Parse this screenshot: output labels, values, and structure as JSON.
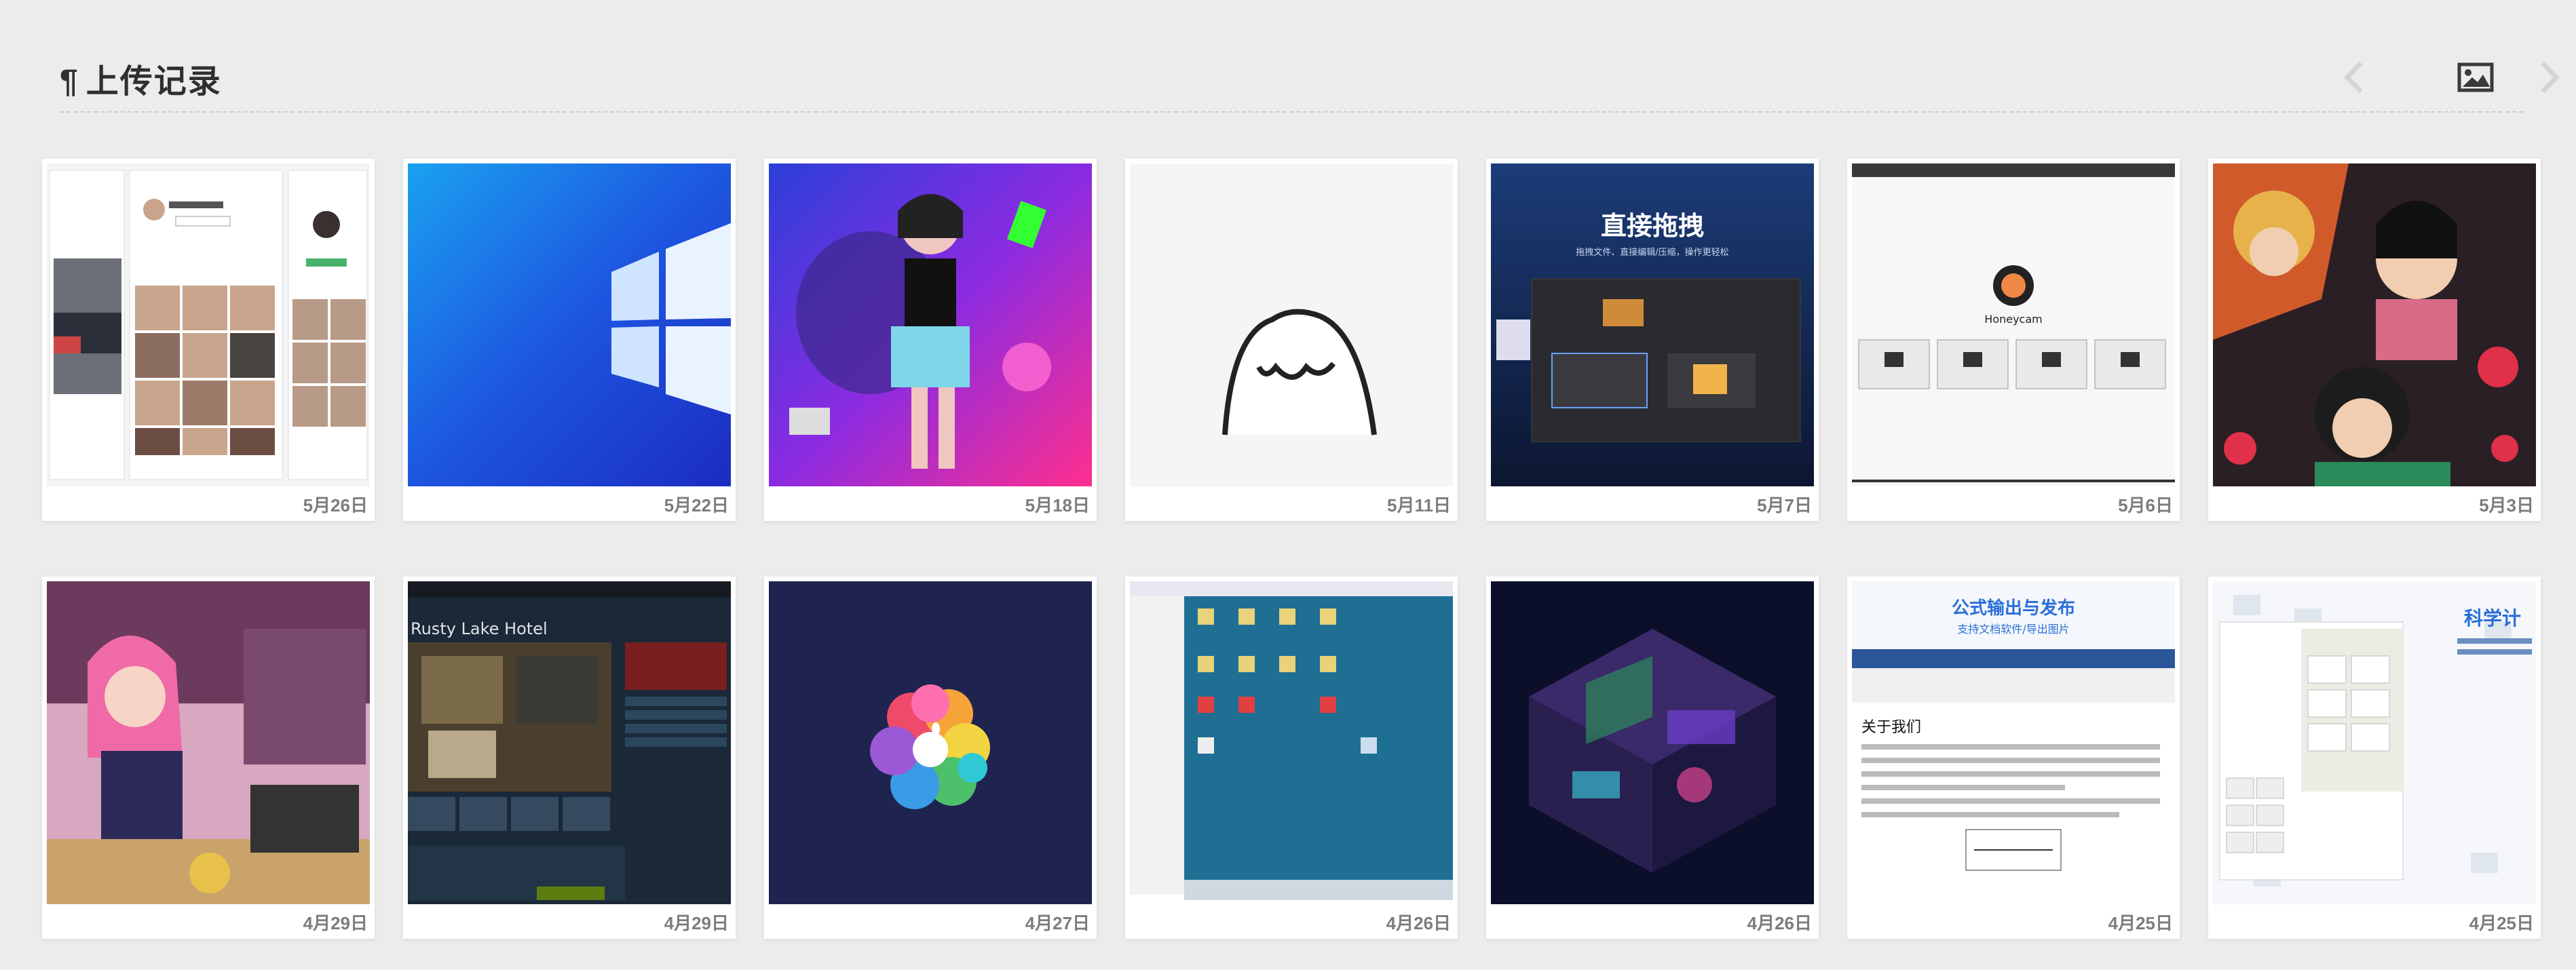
{
  "header": {
    "title": "上传记录",
    "pilcrow": "¶",
    "icons": [
      "chevron-left-icon",
      "image-icon",
      "chevron-right-icon"
    ]
  },
  "records": [
    {
      "date": "5月26日",
      "thumbnail": "social-app-screens"
    },
    {
      "date": "5月22日",
      "thumbnail": "windows-logo"
    },
    {
      "date": "5月18日",
      "thumbnail": "neon-girl-illustration"
    },
    {
      "date": "5月11日",
      "thumbnail": "ghost-sketch"
    },
    {
      "date": "5月7日",
      "thumbnail": "drag-drop-app"
    },
    {
      "date": "5月6日",
      "thumbnail": "honeycam-app"
    },
    {
      "date": "5月3日",
      "thumbnail": "anime-characters"
    },
    {
      "date": "4月29日",
      "thumbnail": "pink-hair-girl-illustration"
    },
    {
      "date": "4月29日",
      "thumbnail": "rusty-lake-hotel-store"
    },
    {
      "date": "4月27日",
      "thumbnail": "apple-flower-logo"
    },
    {
      "date": "4月26日",
      "thumbnail": "desktop-screenshot"
    },
    {
      "date": "4月26日",
      "thumbnail": "isometric-room"
    },
    {
      "date": "4月25日",
      "thumbnail": "formula-publish-doc"
    },
    {
      "date": "4月25日",
      "thumbnail": "scientific-calculator"
    }
  ],
  "thumb_text": {
    "drag_drop_title": "直接拖拽",
    "drag_drop_sub": "拖拽文件、直接编辑/压缩，操作更轻松",
    "honeycam_name": "Honeycam",
    "rusty_lake": "Rusty Lake Hotel",
    "formula_title": "公式输出与发布",
    "formula_sub": "支持文档软件/导出图片",
    "about_us": "关于我们",
    "sci_calc": "科学计"
  }
}
